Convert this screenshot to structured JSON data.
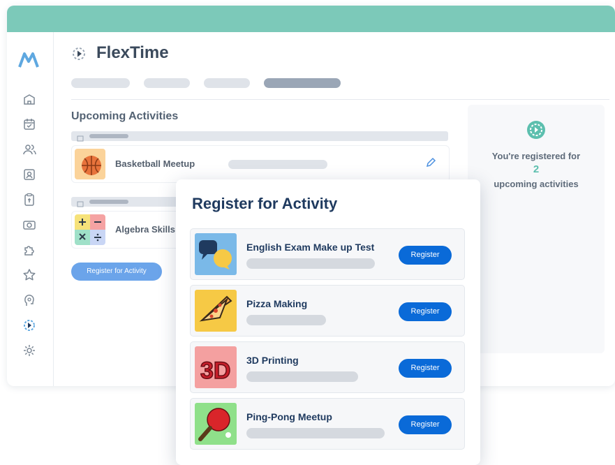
{
  "app": {
    "title": "FlexTime",
    "colors": {
      "topbar": "#7cc9b9",
      "accent": "#0a6ad8",
      "teal": "#5cbfae"
    }
  },
  "sidebar": {
    "icons": [
      "logo-icon",
      "school-icon",
      "calendar-icon",
      "users-icon",
      "id-card-icon",
      "clipboard-icon",
      "camera-icon",
      "puzzle-icon",
      "star-icon",
      "brain-icon",
      "flextime-icon",
      "settings-icon"
    ]
  },
  "main": {
    "section_title": "Upcoming Activities",
    "activities": [
      {
        "name": "Basketball Meetup",
        "icon": "basketball-icon"
      },
      {
        "name": "Algebra Skills",
        "icon": "math-icon"
      }
    ],
    "register_button": "Register for Activity"
  },
  "info": {
    "line1": "You're registered for",
    "count": "2",
    "line2": "upcoming activities"
  },
  "modal": {
    "title": "Register for Activity",
    "items": [
      {
        "name": "English Exam Make up Test",
        "button": "Register",
        "icon": "chat-bubbles-icon"
      },
      {
        "name": "Pizza Making",
        "button": "Register",
        "icon": "pizza-icon"
      },
      {
        "name": "3D Printing",
        "button": "Register",
        "icon": "3d-icon"
      },
      {
        "name": "Ping-Pong Meetup",
        "button": "Register",
        "icon": "ping-pong-icon"
      }
    ]
  }
}
